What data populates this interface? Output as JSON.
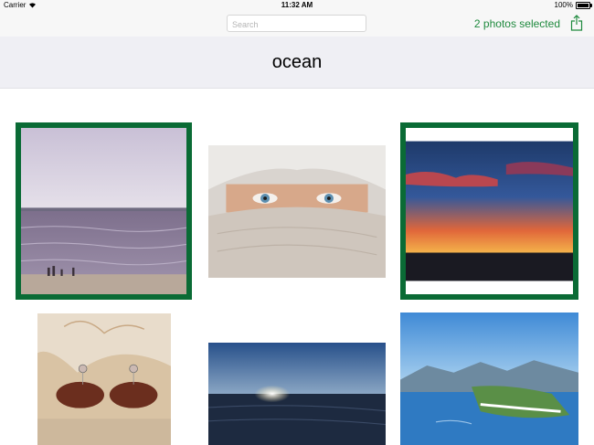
{
  "status_bar": {
    "carrier": "Carrier",
    "time": "11:32 AM",
    "battery_percent": "100%",
    "battery_level": 1.0
  },
  "nav": {
    "search_placeholder": "Search",
    "selection_text": "2 photos selected",
    "share_icon": "share-icon"
  },
  "title": "ocean",
  "colors": {
    "accent": "#1f8a3e",
    "selection_border": "#0a6b35"
  },
  "photos": [
    {
      "subject": "beach with people at shoreline",
      "selected": true
    },
    {
      "subject": "person with blue eyes wrapped in scarf",
      "selected": false
    },
    {
      "subject": "ocean sunset with clouds",
      "selected": true
    },
    {
      "subject": "manatee earrings on shell",
      "selected": false
    },
    {
      "subject": "sun on ocean horizon",
      "selected": false
    },
    {
      "subject": "coastal town aerial view",
      "selected": false
    }
  ]
}
